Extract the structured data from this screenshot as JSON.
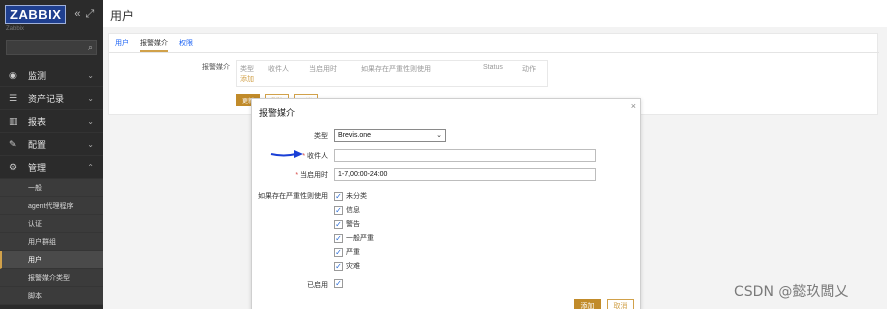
{
  "sidebar": {
    "logo": "ZABBIX",
    "collapse_icon": "collapse-icon",
    "kiosk_icon": "kiosk-icon",
    "server_name": "Zabbix",
    "search_placeholder": "",
    "menu": [
      {
        "label": "监测",
        "icon": "eye-icon"
      },
      {
        "label": "资产记录",
        "icon": "list-icon"
      },
      {
        "label": "报表",
        "icon": "chart-icon"
      },
      {
        "label": "配置",
        "icon": "wrench-icon"
      },
      {
        "label": "管理",
        "icon": "gear-icon"
      }
    ],
    "submenu": [
      {
        "label": "一般"
      },
      {
        "label": "agent代理程序"
      },
      {
        "label": "认证"
      },
      {
        "label": "用户群组"
      },
      {
        "label": "用户"
      },
      {
        "label": "报警媒介类型"
      },
      {
        "label": "脚本"
      }
    ]
  },
  "header": {
    "title": "用户"
  },
  "tabs": [
    {
      "label": "用户"
    },
    {
      "label": "报警媒介"
    },
    {
      "label": "权限"
    }
  ],
  "media_section": {
    "label": "报警媒介",
    "columns": [
      "类型",
      "收件人",
      "当启用时",
      "如果存在严重性则使用",
      "Status",
      "动作"
    ],
    "add_link": "添加",
    "buttons": {
      "update": "更新",
      "delete": "删除",
      "cancel": "取消"
    }
  },
  "modal": {
    "title": "报警媒介",
    "close_icon": "close-icon",
    "type_label": "类型",
    "type_value": "Brevis.one",
    "sendto_label": "收件人",
    "sendto_value": "",
    "period_label": "当启用时",
    "period_value": "1-7,00:00-24:00",
    "severity_label": "如果存在严重性则使用",
    "severities": [
      {
        "label": "未分类",
        "checked": true
      },
      {
        "label": "信息",
        "checked": true
      },
      {
        "label": "警告",
        "checked": true
      },
      {
        "label": "一般严重",
        "checked": true
      },
      {
        "label": "严重",
        "checked": true
      },
      {
        "label": "灾难",
        "checked": true
      }
    ],
    "enabled_label": "已启用",
    "enabled": true,
    "add_button": "添加",
    "cancel_button": "取消"
  },
  "watermark": "CSDN @懿玖闆乂",
  "colors": {
    "accent": "#d1a14a",
    "sidebar_bg": "#2b2b2b",
    "logo_bg": "#1f3f8f",
    "link": "#1f65f4",
    "arrow": "#1a3fd6"
  }
}
